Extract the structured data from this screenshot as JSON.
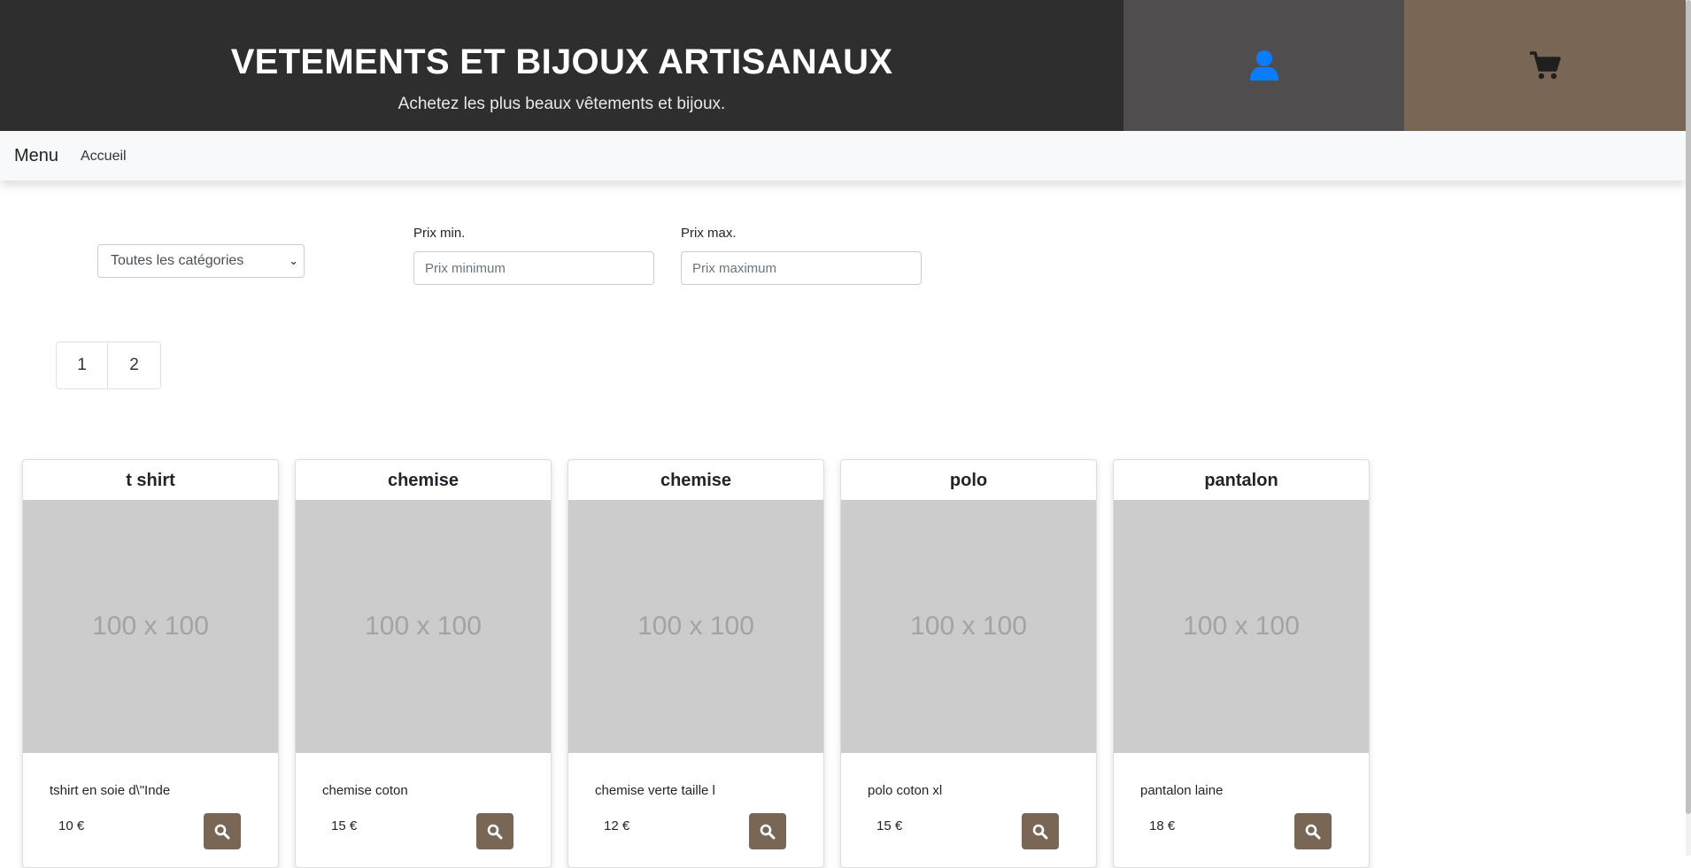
{
  "header": {
    "title": "VETEMENTS ET BIJOUX ARTISANAUX",
    "subtitle": "Achetez les plus beaux vêtements et bijoux.",
    "account_icon": "user-icon",
    "cart_icon": "shopping-cart-icon",
    "colors": {
      "brand_bg": "#2e2e2e",
      "account_bg": "#4f4d4e",
      "cart_bg": "#7a6655",
      "user_icon": "#0a7cff"
    }
  },
  "nav": {
    "menu_label": "Menu",
    "home_label": "Accueil"
  },
  "filters": {
    "category_selected": "Toutes les catégories",
    "min_label": "Prix min.",
    "min_placeholder": "Prix minimum",
    "min_value": "",
    "max_label": "Prix max.",
    "max_placeholder": "Prix maximum",
    "max_value": ""
  },
  "pagination": {
    "pages": [
      "1",
      "2"
    ]
  },
  "products": [
    {
      "name": "t shirt",
      "image_label": "100 x 100",
      "description": "tshirt en soie d\\\"Inde",
      "price": "10 €",
      "action_icon": "search-icon"
    },
    {
      "name": "chemise",
      "image_label": "100 x 100",
      "description": "chemise coton",
      "price": "15 €",
      "action_icon": "search-icon"
    },
    {
      "name": "chemise",
      "image_label": "100 x 100",
      "description": "chemise verte taille l",
      "price": "12 €",
      "action_icon": "search-icon"
    },
    {
      "name": "polo",
      "image_label": "100 x 100",
      "description": "polo coton xl",
      "price": "15 €",
      "action_icon": "search-icon"
    },
    {
      "name": "pantalon",
      "image_label": "100 x 100",
      "description": "pantalon laine",
      "price": "18 €",
      "action_icon": "search-icon"
    }
  ]
}
